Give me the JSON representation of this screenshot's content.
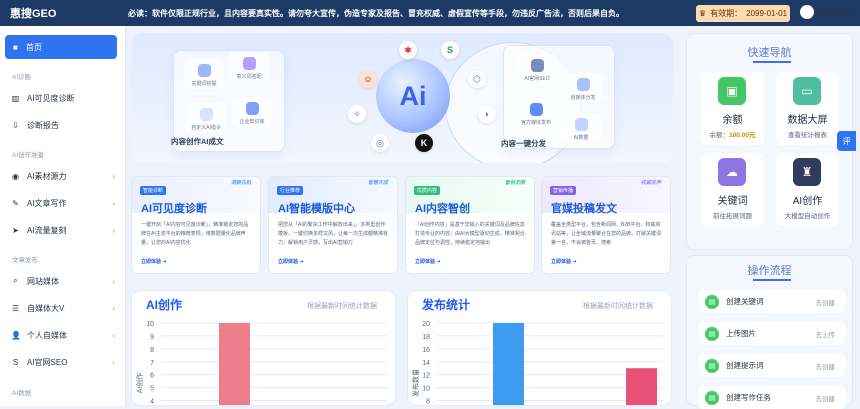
{
  "topbar": {
    "brand": "惠搜GEO",
    "notice": "必读：软件仅限正规行业，且内容要真实性。请勿夸大宣传，伪造专家及报告、冒充权威、虚假宣传等手段，勿违反广告法，否则后果自负。",
    "expire_label": "有效期：",
    "expire_date": "2099-01-01",
    "user_label": "惠搜GEO"
  },
  "sidebar": {
    "home": "首页",
    "section_visibility": "AI诊断",
    "visibility_items": [
      {
        "label": "AI可见度诊断"
      },
      {
        "label": "诊断报告"
      }
    ],
    "section_create": "AI创作准备",
    "create_items": [
      {
        "label": "AI素材源力"
      },
      {
        "label": "AI文章写作"
      },
      {
        "label": "AI流量复刻"
      }
    ],
    "section_publish": "文章发布",
    "publish_items": [
      {
        "label": "网站媒体"
      },
      {
        "label": "自媒体大V"
      },
      {
        "label": "个人自媒体"
      },
      {
        "label": "AI官网SEO"
      }
    ],
    "section_data": "AI数据"
  },
  "hero": {
    "left_items": [
      "关键词挖掘",
      "意义词名配",
      "自定义AI指令",
      "企业知识库"
    ],
    "left_label": "内容创作AI成文",
    "center": "Ai",
    "right_items": [
      "AI官网SEO",
      "自媒体分发",
      "官方媒体发布",
      "AI数据"
    ],
    "right_label": "内容一键分发"
  },
  "features": [
    {
      "tag": "智能诊断",
      "title": "AI可见度诊断",
      "en": "洞察先机",
      "desc": "一键开启「AI内容可见度诊断」，精准锁定您的品牌在AI主流平台的推荐表现，用数据量化品牌声量，让您的AI内容优化",
      "more": "立即体验",
      "color": "#e8f0ff"
    },
    {
      "tag": "行业推荐",
      "title": "AI智能模版中心",
      "en": "智慧天成",
      "desc": "把您从「AI的繁杂工作中解放出来」，多类型创作模板，一键切换多样文风，让每一次生成都精准有力，解锁用户灵感，写出AI营销力",
      "more": "立即体验",
      "color": "#e5efff"
    },
    {
      "tag": "优质内容",
      "title": "AI内容智创",
      "en": "智创无限",
      "desc": "「AI创作内容」是基于您输入的关键词及品牌信息打造专业的内容，由AI大模型驱动生成，精准契合品牌定位与调性，持续稳定地输出",
      "more": "立即体验",
      "color": "#e6f8ef"
    },
    {
      "tag": "营销传播",
      "title": "官媒投稿发文",
      "en": "权威发声",
      "desc": "覆盖全类型平台，包含新闻网、B2B平台、权威资讯站等，让全域流量聚合在您的品牌，打破关键词第一名，不会被首页、搜索",
      "more": "立即体验",
      "color": "#eee9ff"
    }
  ],
  "panels": [
    {
      "title": "AI创作",
      "note": "根据最新时间统计数据"
    },
    {
      "title": "发布统计",
      "note": "根据最新时间统计数据"
    }
  ],
  "chart_data": [
    {
      "type": "bar",
      "title": "AI创作",
      "ylabel": "AI创作",
      "ylim": [
        0,
        10
      ],
      "yticks": [
        "10",
        "9",
        "8",
        "7",
        "6",
        "5",
        "4"
      ],
      "categories": [
        ""
      ],
      "values": [
        10
      ],
      "bar_colors": [
        "#ee7e8c"
      ]
    },
    {
      "type": "bar",
      "title": "发布统计",
      "ylabel": "发布数量",
      "ylim": [
        0,
        20
      ],
      "yticks": [
        "20",
        "18",
        "16",
        "14",
        "12",
        "10",
        "8"
      ],
      "categories": [
        "",
        ""
      ],
      "values": [
        20,
        13
      ],
      "bar_colors": [
        "#3d9bf0",
        "#e85276"
      ]
    }
  ],
  "quick_nav": {
    "title": "快速导航",
    "tiles": [
      {
        "label": "余额",
        "sub_label": "余额：",
        "sub_value": "100.00元",
        "icon": "wallet-icon",
        "color": "#45c768"
      },
      {
        "label": "数据大屏",
        "sub": "查看统计报表",
        "icon": "monitor-icon",
        "color": "#4fbf9f"
      },
      {
        "label": "关键词",
        "sub": "前往拓展词题",
        "icon": "cloud-icon",
        "color": "#8d76e4"
      },
      {
        "label": "AI创作",
        "sub": "大模型自动创作",
        "icon": "ai-icon",
        "color": "#313c5c"
      }
    ]
  },
  "flow": {
    "title": "操作流程",
    "items": [
      {
        "label": "创建关键词",
        "btn": "去创建"
      },
      {
        "label": "上传图片",
        "btn": "去上传"
      },
      {
        "label": "创建提示词",
        "btn": "去创建"
      },
      {
        "label": "创建写作任务",
        "btn": "去创建"
      }
    ]
  },
  "float_tab": "评"
}
